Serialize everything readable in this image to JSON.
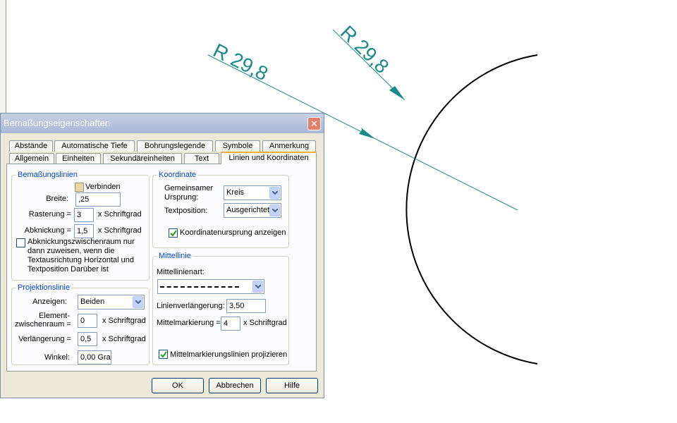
{
  "drawing": {
    "dimension_label_1": "R 29,8",
    "dimension_label_2": "R 29,8",
    "line_color": "#1a8a8a"
  },
  "dialog": {
    "title": "Bemaßungseigenschaften",
    "close_glyph": "✕",
    "tabs_row1": [
      "Abstände",
      "Automatische Tiefe",
      "Bohrungslegende",
      "Symbole",
      "Anmerkung"
    ],
    "tabs_row2": [
      "Allgemein",
      "Einheiten",
      "Sekundäreinheiten",
      "Text",
      "Linien und Koordinaten"
    ],
    "active_tab": "Linien und Koordinaten",
    "bemassungslinien": {
      "legend": "Bemaßungslinien",
      "verbinden_label": "Verbinden",
      "breite_label": "Breite:",
      "breite_value": ",25",
      "rasterung_label": "Rasterung =",
      "rasterung_value": "3",
      "rasterung_unit": "x Schriftgrad",
      "abknickung_label": "Abknickung =",
      "abknickung_value": "1,5",
      "abknickung_unit": "x Schriftgrad",
      "zwischenraum_text": [
        "Abknickungszwischenraum nur",
        "dann zuweisen, wenn die",
        "Textausrichtung Horizontal und",
        "Textposition Darüber ist"
      ]
    },
    "projektionslinie": {
      "legend": "Projektionslinie",
      "anzeigen_label": "Anzeigen:",
      "anzeigen_value": "Beiden",
      "element_label": [
        "Element-",
        "zwischenraum ="
      ],
      "element_value": "0",
      "element_unit": "x Schriftgrad",
      "verlaengerung_label": "Verlängerung =",
      "verlaengerung_value": "0,5",
      "verlaengerung_unit": "x Schriftgrad",
      "winkel_label": "Winkel:",
      "winkel_value": "0,00 Gra"
    },
    "koordinate": {
      "legend": "Koordinate",
      "ursprung_label": [
        "Gemeinsamer",
        "Ursprung:"
      ],
      "ursprung_value": "Kreis",
      "textposition_label": "Textposition:",
      "textposition_value": "Ausgerichtet",
      "anzeigen_label": "Koordinatenursprung anzeigen",
      "anzeigen_checked": true
    },
    "mittellinie": {
      "legend": "Mittellinie",
      "art_label": "Mittellinienart:",
      "verlaengerung_label": "Linienverlängerung:",
      "verlaengerung_value": "3,50",
      "markierung_label": "Mittelmarkierung =",
      "markierung_value": "4",
      "markierung_unit": "x Schriftgrad",
      "projizieren_label": "Mittelmarkierungslinien projizieren",
      "projizieren_checked": true
    },
    "buttons": {
      "ok": "OK",
      "abbrechen": "Abbrechen",
      "hilfe": "Hilfe"
    }
  }
}
